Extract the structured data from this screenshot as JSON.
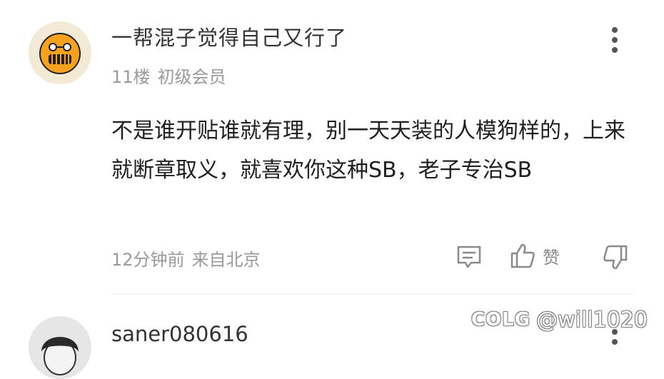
{
  "comment1": {
    "username": "一帮混子觉得自己又行了",
    "floor": "11楼",
    "level": "初级会员",
    "body": "不是谁开贴谁就有理，别一天天装的人模狗样的，上来就断章取义，就喜欢你这种SB，老子专治SB",
    "time": "12分钟前",
    "location": "来自北京",
    "like_label": "赞",
    "avatar_icon": "grinning-face-avatar"
  },
  "comment2": {
    "username": "saner080616",
    "avatar_icon": "person-avatar"
  },
  "watermark": {
    "logo": "COLG",
    "handle": "@will1020"
  },
  "colors": {
    "avatar_orange": "#f6a21e",
    "meta_gray": "#9a9a9a",
    "text": "#1f1f1f"
  }
}
